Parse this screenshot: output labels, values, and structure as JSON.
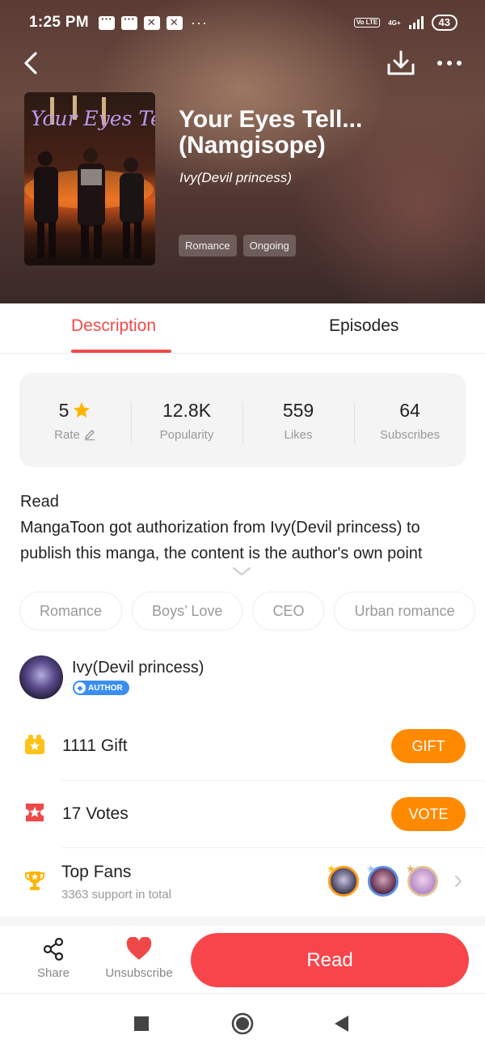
{
  "status_bar": {
    "time": "1:25 PM",
    "more": "···",
    "network_type": "4G+",
    "volte_label": "Vo LTE",
    "battery": "43"
  },
  "header": {
    "icons": [
      "back-icon",
      "download-icon",
      "more-icon"
    ]
  },
  "book": {
    "cover_title": "Your Eyes Tell",
    "title": "Your Eyes Tell... (Namgisope)",
    "author": "Ivy(Devil princess)",
    "tags": [
      "Romance",
      "Ongoing"
    ]
  },
  "tabs": [
    {
      "label": "Description",
      "active": true
    },
    {
      "label": "Episodes",
      "active": false
    }
  ],
  "stats": {
    "rate": {
      "value": "5",
      "label": "Rate"
    },
    "popularity": {
      "value": "12.8K",
      "label": "Popularity"
    },
    "likes": {
      "value": "559",
      "label": "Likes"
    },
    "subscribes": {
      "value": "64",
      "label": "Subscribes"
    }
  },
  "description": {
    "text": "Read\nMangaToon got authorization from Ivy(Devil princess) to publish this manga, the content is the author's own point"
  },
  "genres": [
    "Romance",
    "Boys’ Love",
    "CEO",
    "Urban romance"
  ],
  "author": {
    "name": "Ivy(Devil princess)",
    "badge": "AUTHOR"
  },
  "gift": {
    "text": "1111 Gift",
    "button": "GIFT"
  },
  "votes": {
    "text": "17 Votes",
    "button": "VOTE"
  },
  "top_fans": {
    "title": "Top Fans",
    "subtitle": "3363 support in total"
  },
  "bottom_bar": {
    "share": "Share",
    "unsubscribe": "Unsubscribe",
    "read": "Read"
  },
  "colors": {
    "accent_red": "#f24a4a",
    "read_button": "#f8454b",
    "orange_button": "#ff8a00",
    "author_badge": "#3a8ef0",
    "star": "#ffb400"
  }
}
